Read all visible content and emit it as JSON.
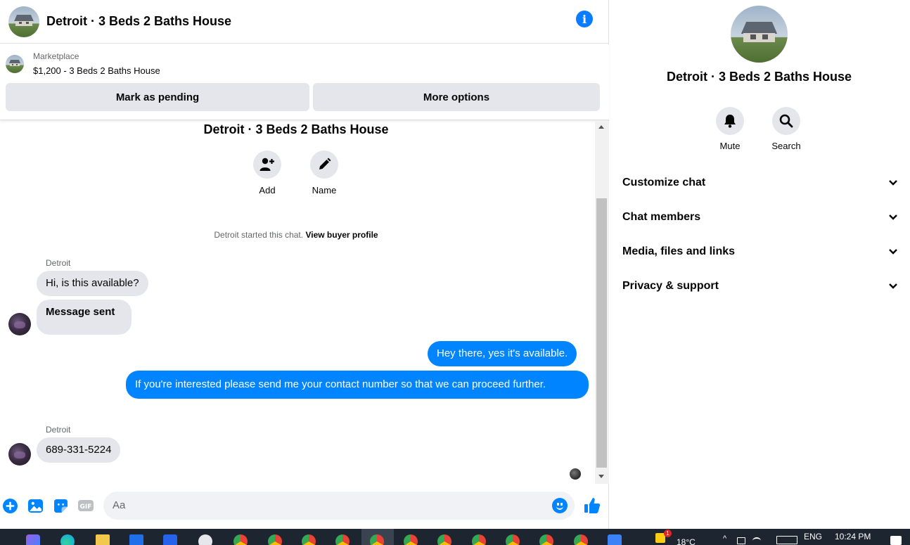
{
  "header": {
    "title": "Detroit · 3 Beds 2 Baths House"
  },
  "marketplace": {
    "label": "Marketplace",
    "listing": "$1,200 - 3 Beds 2 Baths House",
    "pending_button": "Mark as pending",
    "more_button": "More options"
  },
  "conversation": {
    "title": "Detroit · 3 Beds 2 Baths House",
    "add_label": "Add",
    "name_label": "Name",
    "started_text": "Detroit started this chat.",
    "profile_link": "View buyer profile",
    "messages": [
      {
        "sender": "Detroit",
        "text": "Hi, is this available?",
        "direction": "in"
      },
      {
        "text": "Message sent",
        "direction": "in"
      },
      {
        "text": "Hey there, yes it's available.",
        "direction": "out"
      },
      {
        "text": "If you're interested please send me your contact number so that we can proceed further.",
        "direction": "out"
      },
      {
        "sender": "Detroit",
        "text": "689-331-5224",
        "direction": "in"
      }
    ]
  },
  "composer": {
    "placeholder": "Aa"
  },
  "info_panel": {
    "name": "Detroit · 3 Beds 2 Baths House",
    "mute_label": "Mute",
    "search_label": "Search",
    "sections": [
      "Customize chat",
      "Chat members",
      "Media, files and links",
      "Privacy & support"
    ]
  },
  "taskbar": {
    "temperature": "18°C",
    "weather_badge": "1",
    "language": "ENG",
    "time": "10:24 PM"
  },
  "colors": {
    "accent": "#0084ff",
    "bubble_in": "#e4e6eb",
    "taskbar": "#1c2530"
  }
}
